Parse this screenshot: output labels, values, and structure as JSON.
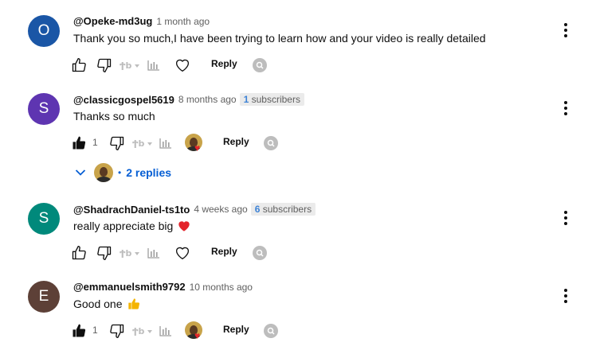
{
  "comments": [
    {
      "avatar_letter": "O",
      "avatar_color": "#1a56a6",
      "author": "@Opeke-md3ug",
      "time": "1 month ago",
      "subs_count": "",
      "subs_label": "",
      "text": "Thank you so much,I have been trying to learn how and your video is really detailed",
      "emoji": "",
      "likes": "",
      "liked": false,
      "creator_heart": false,
      "reply_label": "Reply"
    },
    {
      "avatar_letter": "S",
      "avatar_color": "#5e35b1",
      "author": "@classicgospel5619",
      "time": "8 months ago",
      "subs_count": "1",
      "subs_label": "subscribers",
      "text": "Thanks so much",
      "emoji": "",
      "likes": "1",
      "liked": true,
      "creator_heart": true,
      "reply_label": "Reply",
      "replies": "2 replies"
    },
    {
      "avatar_letter": "S",
      "avatar_color": "#00897b",
      "author": "@ShadrachDaniel-ts1to",
      "time": "4 weeks ago",
      "subs_count": "6",
      "subs_label": "subscribers",
      "text": "really appreciate big",
      "emoji": "heart",
      "likes": "",
      "liked": false,
      "creator_heart": false,
      "reply_label": "Reply"
    },
    {
      "avatar_letter": "E",
      "avatar_color": "#5d4037",
      "author": "@emmanuelsmith9792",
      "time": "10 months ago",
      "subs_count": "",
      "subs_label": "",
      "text": "Good one",
      "emoji": "thumbs-up",
      "likes": "1",
      "liked": true,
      "creator_heart": true,
      "reply_label": "Reply"
    }
  ],
  "colors": {
    "link_blue": "#065fd4",
    "subs_blue": "#3e83d6",
    "heart_red": "#e3242b",
    "thumb_yellow": "#f4b400"
  }
}
